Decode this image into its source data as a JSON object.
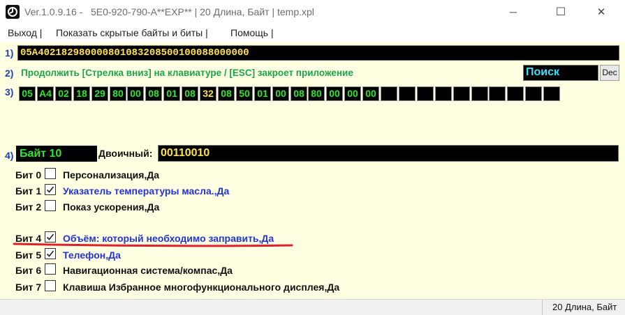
{
  "window": {
    "title": "Ver.1.0.9.16 -   5E0-920-790-A**EXP** | 20 Длина, Байт | temp.xpl",
    "minimize": "─",
    "maximize": "☐",
    "close": "✕"
  },
  "menu": {
    "items": [
      "Выход",
      "Показать скрытые байты и биты",
      "Помощь"
    ],
    "separator": "|"
  },
  "row1": {
    "num": "1)",
    "hex": "05A402182980000801083208500100088000000"
  },
  "row2": {
    "num": "2)",
    "message": "Продолжить [Стрелка вниз] на клавиатуре / [ESC] закроет приложение",
    "search_label": "Поиск",
    "dec_label": "Dec"
  },
  "row3": {
    "num": "3)",
    "bytes": [
      "05",
      "A4",
      "02",
      "18",
      "29",
      "80",
      "00",
      "08",
      "01",
      "08",
      "32",
      "08",
      "50",
      "01",
      "00",
      "08",
      "80",
      "00",
      "00",
      "00",
      "",
      "",
      "",
      "",
      "",
      "",
      "",
      "",
      "",
      ""
    ],
    "selected_index": 10,
    "colors": {
      "normal": "#2ee62e",
      "selected": "#ffe14a"
    }
  },
  "row4": {
    "num": "4)",
    "byte_label": "Байт 10",
    "binary_label": "Двоичный:",
    "binary_value": "00110010"
  },
  "bits": [
    {
      "name": "Бит 0",
      "checked": false,
      "desc": "Персонализация,Да",
      "color": "#111111"
    },
    {
      "name": "Бит 1",
      "checked": true,
      "desc": "Указатель температуры масла.,Да",
      "color": "#2233dd"
    },
    {
      "name": "Бит 2",
      "checked": false,
      "desc": "Показ ускорения,Да",
      "color": "#111111"
    },
    {
      "name": "Бит 4",
      "checked": true,
      "desc": "Объём: который необходимо заправить,Да",
      "color": "#2233dd"
    },
    {
      "name": "Бит 5",
      "checked": true,
      "desc": "Телефон,Да",
      "color": "#2233dd"
    },
    {
      "name": "Бит 6",
      "checked": false,
      "desc": "Навигационная система/компас,Да",
      "color": "#111111"
    },
    {
      "name": "Бит 7",
      "checked": false,
      "desc": "Клавиша Избранное многофункционального дисплея,Да",
      "color": "#111111"
    }
  ],
  "status": {
    "text": "20 Длина, Байт"
  }
}
